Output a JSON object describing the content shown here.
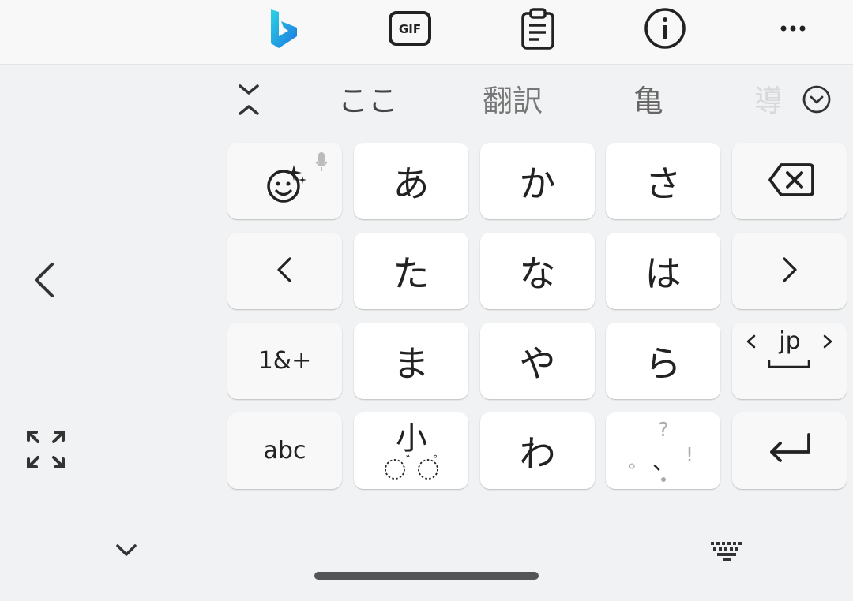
{
  "toolbar": {
    "icons": [
      "bing-icon",
      "gif-icon",
      "clipboard-icon",
      "info-icon",
      "more-icon"
    ],
    "gif_label": "GIF"
  },
  "candidates": {
    "items": [
      "ここ",
      "翻訳",
      "亀",
      "導"
    ]
  },
  "keys": {
    "row1": [
      "",
      "あ",
      "か",
      "さ",
      ""
    ],
    "row2": [
      "",
      "た",
      "な",
      "は",
      ""
    ],
    "row3": [
      "1&+",
      "ま",
      "や",
      "ら",
      "jp"
    ],
    "row4": [
      "abc",
      "小",
      "わ",
      "",
      ""
    ],
    "small_marks": [
      "゛",
      "゜"
    ],
    "punct": {
      "question": "?",
      "maru": "。",
      "ten": "、",
      "excl": "!"
    }
  },
  "colors": {
    "bing_blue": "#1b75e0",
    "bing_teal": "#2bd4e4",
    "key_bg": "#ffffff",
    "fn_key_bg": "#f8f8f8",
    "keyboard_bg": "#f1f2f3"
  }
}
